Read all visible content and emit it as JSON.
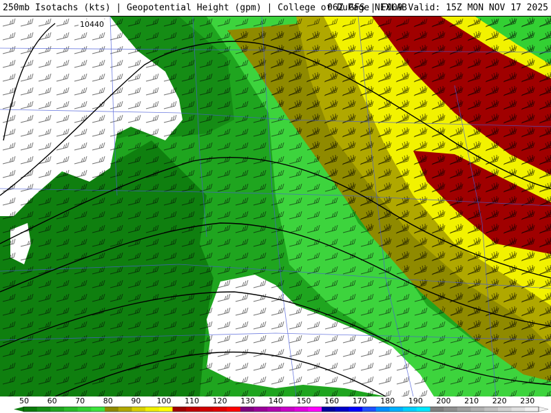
{
  "header": {
    "title_left": "250mb Isotachs (kts) | Geopotential Height (gpm) | College of DuPage NEXLAB",
    "title_right": "06Z GFS | F009 Valid: 15Z MON NOV 17 2025"
  },
  "map": {
    "contour_label": "10440",
    "background_color": "#ffffff",
    "barb_color": "#000000",
    "border_color": "#4a5cd8"
  },
  "scale": {
    "labels": [
      "50",
      "60",
      "70",
      "80",
      "90",
      "100",
      "110",
      "120",
      "130",
      "140",
      "150",
      "160",
      "170",
      "180",
      "190",
      "200",
      "210",
      "220",
      "230"
    ],
    "colors": [
      "#0a7a0a",
      "#169016",
      "#1fa51f",
      "#29bb29",
      "#33d033",
      "#3de33d",
      "#8f8a00",
      "#b0a800",
      "#d8d000",
      "#f0f000",
      "#ffff00",
      "#a00000",
      "#c00000",
      "#d00000",
      "#e00000",
      "#ff0000",
      "#800080",
      "#9a009a",
      "#b000b0",
      "#c800c8",
      "#e000e0",
      "#ff00ff",
      "#0000a0",
      "#0000c8",
      "#0000ff",
      "#2050ff",
      "#0090ff",
      "#00b0ff",
      "#00d0ff",
      "#00e8ff",
      "#808080",
      "#909090",
      "#a0a0a0",
      "#b0b0b0",
      "#c0c0c0",
      "#d0d0d0",
      "#e0e0e0",
      "#f0f0f0"
    ]
  }
}
